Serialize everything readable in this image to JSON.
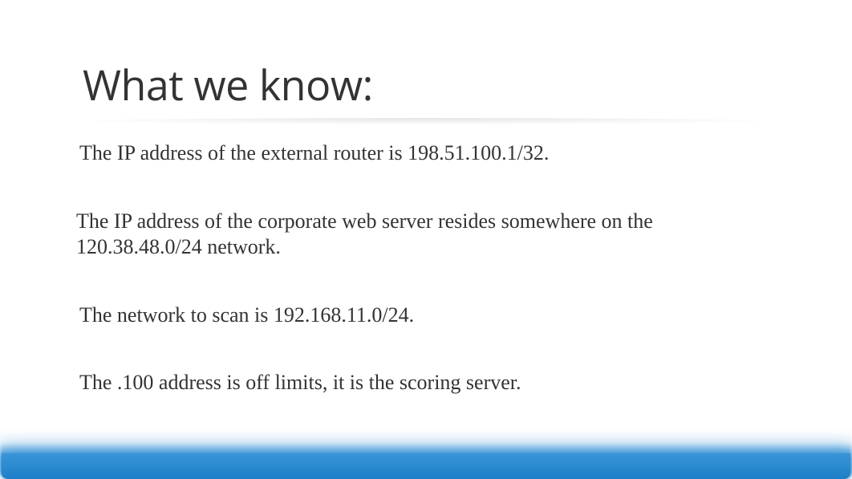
{
  "heading": "What we know:",
  "paragraphs": [
    "The IP address of the external router is 198.51.100.1/32.",
    "The IP address of the corporate web server resides somewhere on the 120.38.48.0/24 network.",
    "The network to scan is 192.168.11.0/24.",
    "The .100 address is off limits, it is the scoring server."
  ]
}
